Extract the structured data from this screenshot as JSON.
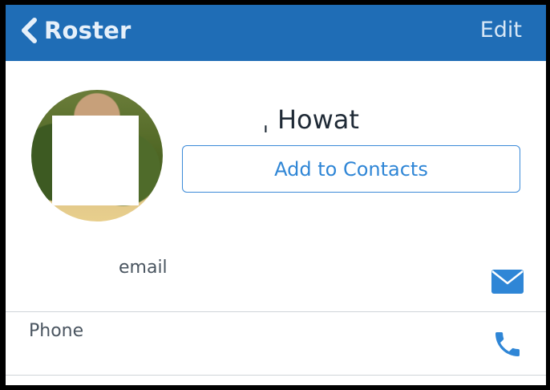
{
  "nav": {
    "back_label": "Roster",
    "edit_label": "Edit",
    "bar_color": "#1f6db6"
  },
  "profile": {
    "name": "ˌ Howat",
    "add_contacts_label": "Add to Contacts"
  },
  "rows": {
    "email_label": "email",
    "phone_label": "Phone"
  },
  "icons": {
    "back": "chevron-left-icon",
    "mail": "envelope-icon",
    "phone": "phone-icon"
  },
  "colors": {
    "accent": "#2f86d6"
  }
}
